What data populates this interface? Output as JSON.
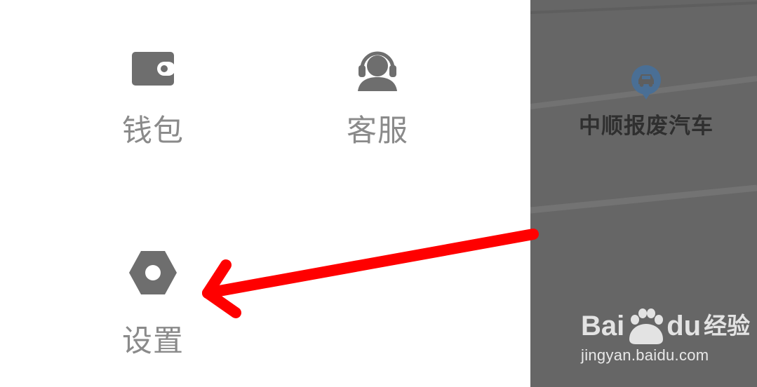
{
  "drawer": {
    "items": [
      {
        "label": "钱包",
        "icon": "wallet-icon"
      },
      {
        "label": "客服",
        "icon": "headset-icon"
      },
      {
        "label": "设置",
        "icon": "settings-nut-icon"
      }
    ]
  },
  "map": {
    "poi_name": "中顺报废汽车",
    "poi_icon": "car-location-pin-icon"
  },
  "watermark": {
    "brand_left": "Bai",
    "brand_right": "du",
    "product": "经验",
    "url": "jingyan.baidu.com"
  },
  "annotation": {
    "arrow_color": "#ff0000",
    "arrow_target": "settings"
  },
  "colors": {
    "icon_gray": "#6e6e6e",
    "label_gray": "#8a8a8a",
    "overlay": "#666666",
    "pin_blue": "#4a6f95"
  }
}
